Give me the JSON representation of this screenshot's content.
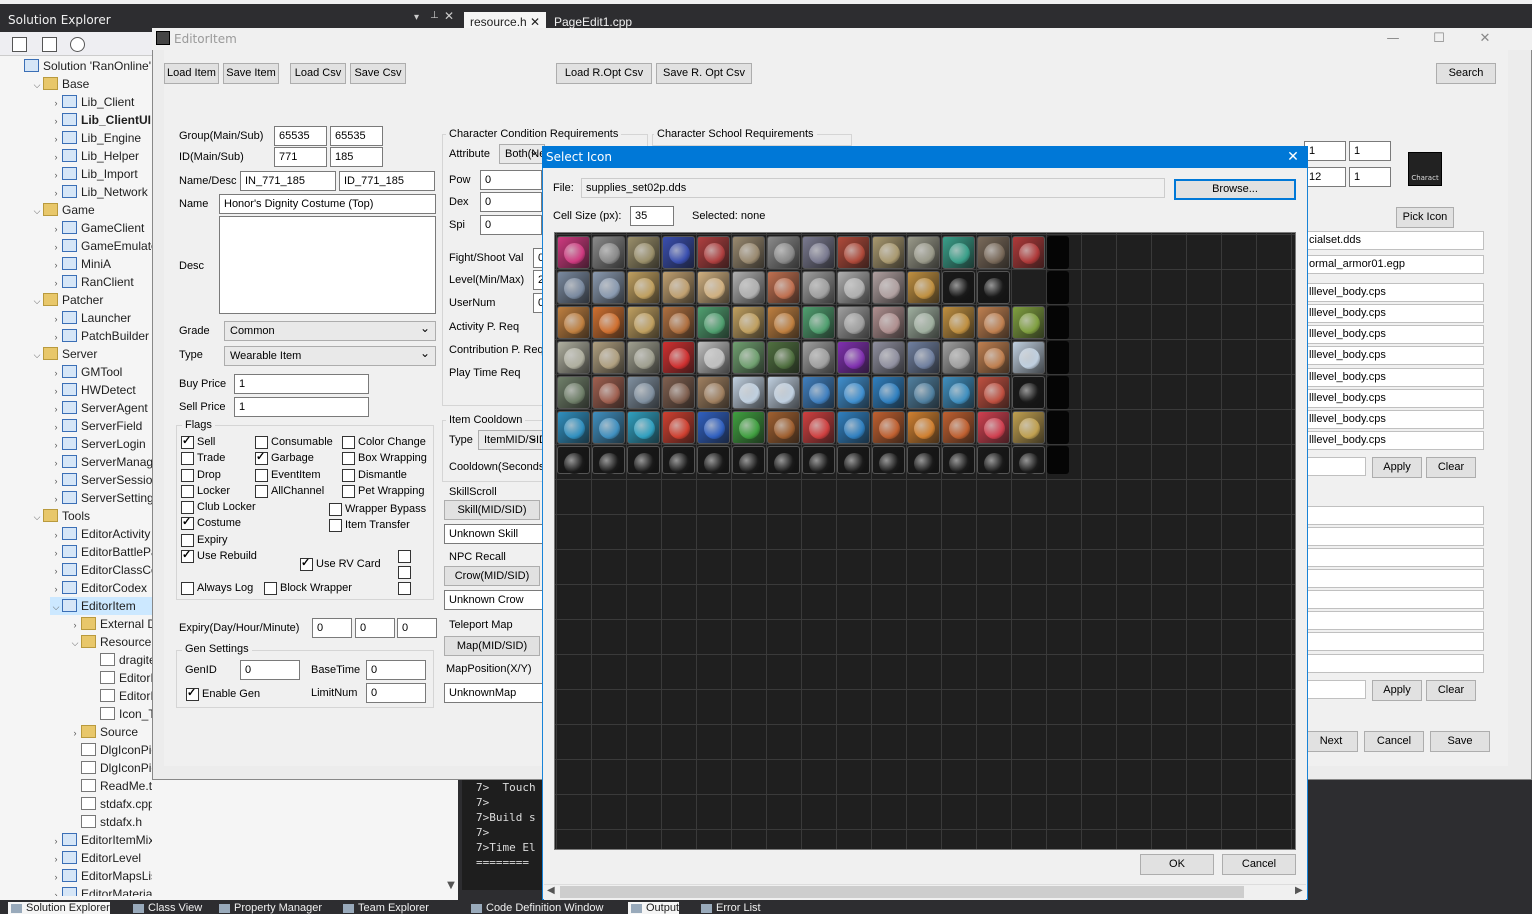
{
  "top_tabs": {
    "solution_explorer_title": "Solution Explorer",
    "tab1": "resource.h",
    "tab2": "PageEdit1.cpp"
  },
  "tree": [
    {
      "label": "Solution 'RanOnline'",
      "indent": 0,
      "arrow": "",
      "icon": "solution",
      "bold": false,
      "sel": false
    },
    {
      "label": "Base",
      "indent": 1,
      "arrow": "v",
      "icon": "folder"
    },
    {
      "label": "Lib_Client",
      "indent": 2,
      "arrow": ">",
      "icon": "proj"
    },
    {
      "label": "Lib_ClientUI",
      "indent": 2,
      "arrow": ">",
      "icon": "proj",
      "bold": true
    },
    {
      "label": "Lib_Engine",
      "indent": 2,
      "arrow": ">",
      "icon": "proj"
    },
    {
      "label": "Lib_Helper",
      "indent": 2,
      "arrow": ">",
      "icon": "proj"
    },
    {
      "label": "Lib_Import",
      "indent": 2,
      "arrow": ">",
      "icon": "proj"
    },
    {
      "label": "Lib_Network",
      "indent": 2,
      "arrow": ">",
      "icon": "proj"
    },
    {
      "label": "Game",
      "indent": 1,
      "arrow": "v",
      "icon": "folder"
    },
    {
      "label": "GameClient",
      "indent": 2,
      "arrow": ">",
      "icon": "proj"
    },
    {
      "label": "GameEmulator",
      "indent": 2,
      "arrow": ">",
      "icon": "proj"
    },
    {
      "label": "MiniA",
      "indent": 2,
      "arrow": ">",
      "icon": "proj"
    },
    {
      "label": "RanClient",
      "indent": 2,
      "arrow": ">",
      "icon": "proj"
    },
    {
      "label": "Patcher",
      "indent": 1,
      "arrow": "v",
      "icon": "folder"
    },
    {
      "label": "Launcher",
      "indent": 2,
      "arrow": ">",
      "icon": "proj"
    },
    {
      "label": "PatchBuilder",
      "indent": 2,
      "arrow": ">",
      "icon": "proj"
    },
    {
      "label": "Server",
      "indent": 1,
      "arrow": "v",
      "icon": "folder"
    },
    {
      "label": "GMTool",
      "indent": 2,
      "arrow": ">",
      "icon": "proj"
    },
    {
      "label": "HWDetect",
      "indent": 2,
      "arrow": ">",
      "icon": "proj"
    },
    {
      "label": "ServerAgent",
      "indent": 2,
      "arrow": ">",
      "icon": "proj"
    },
    {
      "label": "ServerField",
      "indent": 2,
      "arrow": ">",
      "icon": "proj"
    },
    {
      "label": "ServerLogin",
      "indent": 2,
      "arrow": ">",
      "icon": "proj"
    },
    {
      "label": "ServerManager",
      "indent": 2,
      "arrow": ">",
      "icon": "proj"
    },
    {
      "label": "ServerSession",
      "indent": 2,
      "arrow": ">",
      "icon": "proj"
    },
    {
      "label": "ServerSetting",
      "indent": 2,
      "arrow": ">",
      "icon": "proj"
    },
    {
      "label": "Tools",
      "indent": 1,
      "arrow": "v",
      "icon": "folder"
    },
    {
      "label": "EditorActivity",
      "indent": 2,
      "arrow": ">",
      "icon": "proj"
    },
    {
      "label": "EditorBattlePass",
      "indent": 2,
      "arrow": ">",
      "icon": "proj"
    },
    {
      "label": "EditorClassConst",
      "indent": 2,
      "arrow": ">",
      "icon": "proj"
    },
    {
      "label": "EditorCodex",
      "indent": 2,
      "arrow": ">",
      "icon": "proj"
    },
    {
      "label": "EditorItem",
      "indent": 2,
      "arrow": "v",
      "icon": "proj",
      "sel": true
    },
    {
      "label": "External Dependencies",
      "indent": 3,
      "arrow": ">",
      "icon": "folder"
    },
    {
      "label": "Resource Files",
      "indent": 3,
      "arrow": "v",
      "icon": "folder"
    },
    {
      "label": "dragitem.cur",
      "indent": 4,
      "arrow": "",
      "icon": "file"
    },
    {
      "label": "EditorItem.ico",
      "indent": 4,
      "arrow": "",
      "icon": "file"
    },
    {
      "label": "EditorItem.rc2",
      "indent": 4,
      "arrow": "",
      "icon": "file"
    },
    {
      "label": "Icon_Tool.bmp",
      "indent": 4,
      "arrow": "",
      "icon": "file"
    },
    {
      "label": "Source",
      "indent": 3,
      "arrow": ">",
      "icon": "folder"
    },
    {
      "label": "DlgIconPicker.cpp",
      "indent": 3,
      "arrow": "",
      "icon": "file"
    },
    {
      "label": "DlgIconPicker.h",
      "indent": 3,
      "arrow": "",
      "icon": "file"
    },
    {
      "label": "ReadMe.txt",
      "indent": 3,
      "arrow": "",
      "icon": "file"
    },
    {
      "label": "stdafx.cpp",
      "indent": 3,
      "arrow": "",
      "icon": "file"
    },
    {
      "label": "stdafx.h",
      "indent": 3,
      "arrow": "",
      "icon": "file"
    },
    {
      "label": "EditorItemMix",
      "indent": 2,
      "arrow": ">",
      "icon": "proj"
    },
    {
      "label": "EditorLevel",
      "indent": 2,
      "arrow": ">",
      "icon": "proj"
    },
    {
      "label": "EditorMapsList",
      "indent": 2,
      "arrow": ">",
      "icon": "proj"
    },
    {
      "label": "EditorMaterial",
      "indent": 2,
      "arrow": ">",
      "icon": "proj"
    }
  ],
  "bottom_tabs": [
    "Solution Explorer",
    "Class View",
    "Property Manager",
    "Team Explorer",
    "Code Definition Window",
    "Output",
    "Error List"
  ],
  "console_lines": [
    "7>  Touch",
    "7>",
    "7>Build s",
    "7>",
    "7>Time El",
    "========"
  ],
  "editor": {
    "title": "EditorItem",
    "toolbar": {
      "load_item": "Load Item",
      "save_item": "Save Item",
      "load_csv": "Load Csv",
      "save_csv": "Save Csv",
      "load_ropt": "Load R.Opt Csv",
      "save_ropt": "Save R. Opt Csv",
      "search": "Search"
    },
    "group_label": "Group(Main/Sub)",
    "group_main": "65535",
    "group_sub": "65535",
    "id_label": "ID(Main/Sub)",
    "id_main": "771",
    "id_sub": "185",
    "namedesc_label": "Name/Desc",
    "name_key": "IN_771_185",
    "desc_key": "ID_771_185",
    "name_label": "Name",
    "name_value": "Honor's Dignity Costume (Top)",
    "desc_label": "Desc",
    "grade_label": "Grade",
    "grade_value": "Common",
    "type_label": "Type",
    "type_value": "Wearable Item",
    "buy_label": "Buy Price",
    "buy_value": "1",
    "sell_label": "Sell Price",
    "sell_value": "1",
    "flags_title": "Flags",
    "flags": {
      "sell": "Sell",
      "trade": "Trade",
      "drop": "Drop",
      "locker": "Locker",
      "club_locker": "Club Locker",
      "costume": "Costume",
      "expiry": "Expiry",
      "use_rebuild": "Use Rebuild",
      "consumable": "Consumable",
      "garbage": "Garbage",
      "eventitem": "EventItem",
      "allchannel": "AllChannel",
      "color_change": "Color Change",
      "box_wrapping": "Box Wrapping",
      "dismantle": "Dismantle",
      "pet_wrapping": "Pet Wrapping",
      "wrapper_bypass": "Wrapper Bypass",
      "item_transfer": "Item Transfer",
      "use_rv_card": "Use RV Card",
      "always_log": "Always Log",
      "block_wrapper": "Block Wrapper"
    },
    "expiry_label": "Expiry(Day/Hour/Minute)",
    "expiry_d": "0",
    "expiry_h": "0",
    "expiry_m": "0",
    "gen_title": "Gen Settings",
    "genid_label": "GenID",
    "genid": "0",
    "basetime_label": "BaseTime",
    "basetime": "0",
    "enable_gen": "Enable Gen",
    "limitnum_label": "LimitNum",
    "limitnum": "0",
    "char_cond_title": "Character Condition Requirements",
    "char_school_title": "Character School Requirements",
    "attribute_label": "Attribute",
    "attribute_value": "Both(Ne",
    "pow_label": "Pow",
    "pow": "0",
    "dex_label": "Dex",
    "dex": "0",
    "spi_label": "Spi",
    "spi": "0",
    "fight_label": "Fight/Shoot Val",
    "fight": "0",
    "level_label": "Level(Min/Max)",
    "level": "2",
    "usernum_label": "UserNum",
    "usernum": "0",
    "activity_label": "Activity P. Req",
    "contribution_label": "Contribution P. Req",
    "playtime_label": "Play Time Req",
    "cooldown_title": "Item Cooldown",
    "cd_type_label": "Type",
    "cd_type_value": "ItemMID/SID",
    "cd_seconds_label": "Cooldown(Seconds)",
    "skillscroll_title": "SkillScroll",
    "skill_btn": "Skill(MID/SID)",
    "skill_value": "Unknown Skill",
    "npc_title": "NPC Recall",
    "crow_btn": "Crow(MID/SID)",
    "crow_value": "Unknown Crow",
    "teleport_title": "Teleport Map",
    "map_btn": "Map(MID/SID)",
    "mappos_label": "MapPosition(X/Y)",
    "map_value": "UnknownMap",
    "right": {
      "f1a": "1",
      "f1b": "1",
      "f2a": "12",
      "f2b": "1",
      "pick_icon": "Pick Icon",
      "icon_thumb": "Charact",
      "file1": "cialset.dds",
      "file2": "ormal_armor01.egp",
      "cps": [
        "lllevel_body.cps",
        "lllevel_body.cps",
        "lllevel_body.cps",
        "lllevel_body.cps",
        "lllevel_body.cps",
        "lllevel_body.cps",
        "lllevel_body.cps",
        "lllevel_body.cps"
      ],
      "apply": "Apply",
      "clear": "Clear",
      "next": "Next",
      "cancel": "Cancel",
      "save": "Save"
    }
  },
  "dialog": {
    "title": "Select Icon",
    "file_label": "File:",
    "file_value": "supplies_set02p.dds",
    "browse": "Browse...",
    "cellsize_label": "Cell Size (px):",
    "cellsize_value": "35",
    "selected": "Selected: none",
    "ok": "OK",
    "cancel": "Cancel"
  },
  "icon_rows": [
    [
      "#d03a80",
      "#8a8a8a",
      "#9a8f6a",
      "#3a4fb0",
      "#b04040",
      "#9a8a70",
      "#8a8a8a",
      "#7a7a90",
      "#b04a3a",
      "#aa9a70",
      "#9a9a8a",
      "#3aa08a",
      "#7a6a5a",
      "#b03a3a"
    ],
    [
      "#7a8aa0",
      "#8a9ab0",
      "#c0a060",
      "#c0a070",
      "#d0b080",
      "#b0b0b0",
      "#c07050",
      "#a0a0a0",
      "#b0b0b0",
      "#b0a0a0",
      "#c09040",
      "#1a1a1a",
      "#1a1a1a"
    ],
    [
      "#c08040",
      "#d07030",
      "#c0a060",
      "#b07040",
      "#50a070",
      "#c0a060",
      "#c08040",
      "#50a070",
      "#a0a0a0",
      "#b09090",
      "#a0b0a0",
      "#c09040",
      "#c08050",
      "#80a040"
    ],
    [
      "#b0b0a0",
      "#b0a080",
      "#a0a090",
      "#d03030",
      "#c0c0c0",
      "#70a070",
      "#507040",
      "#a0a0a0",
      "#8030b0",
      "#9090a0",
      "#7080a0",
      "#a0a0a0",
      "#c08050",
      "#c0d0e0"
    ],
    [
      "#70806a",
      "#a06050",
      "#8090a0",
      "#806050",
      "#a08060",
      "#c0d0e0",
      "#c0d0e0",
      "#4080c0",
      "#4090d0",
      "#3080c0",
      "#5080a0",
      "#4090c0",
      "#c05040",
      "#1a1a1a"
    ],
    [
      "#3090c0",
      "#4090c0",
      "#30a0c0",
      "#d04030",
      "#3060c0",
      "#40a040",
      "#a06030",
      "#d04040",
      "#3080c0",
      "#c06030",
      "#d08030",
      "#c06030",
      "#d04050",
      "#c0a050"
    ],
    [
      "#1a1a1a",
      "#1a1a1a",
      "#1a1a1a",
      "#1a1a1a",
      "#1a1a1a",
      "#1a1a1a",
      "#1a1a1a",
      "#1a1a1a",
      "#1a1a1a",
      "#1a1a1a",
      "#1a1a1a",
      "#1a1a1a",
      "#1a1a1a",
      "#1a1a1a"
    ]
  ]
}
